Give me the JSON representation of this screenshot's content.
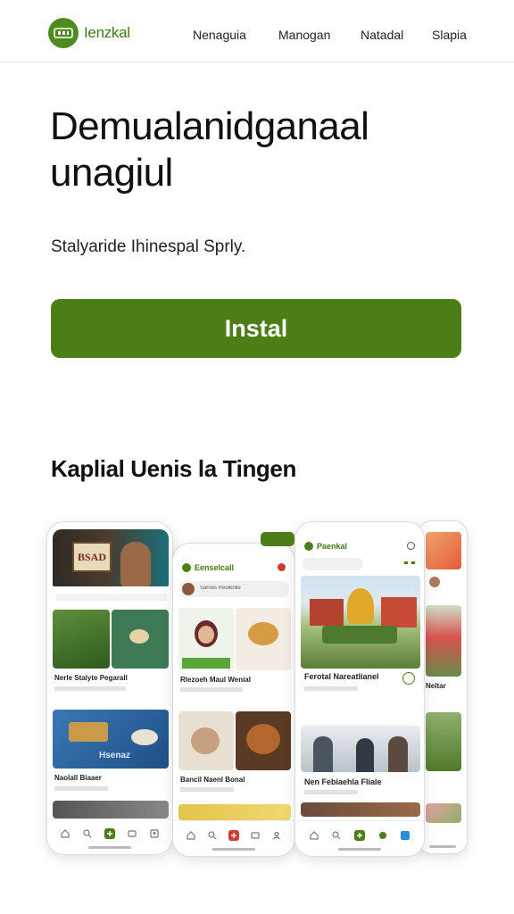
{
  "header": {
    "brand": "Ienzkal",
    "nav": [
      "Nenaguia",
      "Manogan",
      "Natadal",
      "Slapia"
    ]
  },
  "hero": {
    "title": "Demualanidganaal unagiul",
    "subtitle": "Stalyaride Ihinespal Sprly.",
    "install_label": "Instal"
  },
  "preview": {
    "title": "Kaplial Uenis la Tingen",
    "phone1": {
      "sign": "BSAD",
      "card1_caption": "Nerle Stalyte Pegarall",
      "card2_sign": "Hsenaz",
      "card2_caption": "Naolall Biaaer",
      "icons": [
        "home-icon",
        "search-icon",
        "add-icon",
        "message-icon",
        "profile-icon"
      ]
    },
    "phone2": {
      "app_title": "Eenselcall",
      "search_text": "Sarnes Reolenlle",
      "card1_caption": "Rlezoeh Maul Wenial",
      "card2_caption": "Bancil Naenl Bonal"
    },
    "phone3": {
      "app_title": "Paenkal",
      "card1_caption": "Ferotal Nareatlianel",
      "card2_caption": "Nen Febiaehla Fliale"
    },
    "phone4": {
      "caption": "Neltar"
    }
  },
  "colors": {
    "brand_green": "#4d7d17",
    "accent_red": "#d23b2f"
  }
}
